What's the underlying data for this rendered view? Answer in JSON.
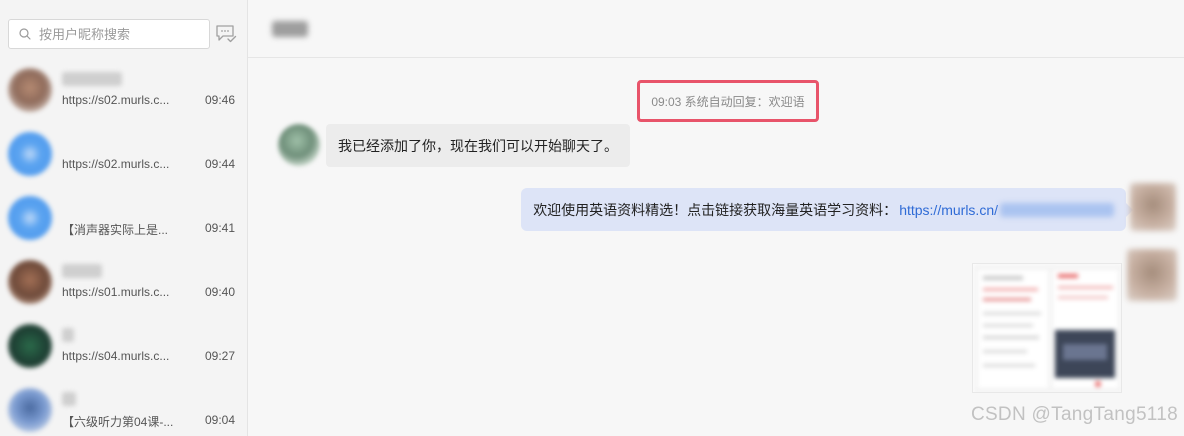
{
  "search": {
    "placeholder": "按用户昵称搜索"
  },
  "icons": {
    "search": "search-icon",
    "message_check": "message-check-icon"
  },
  "conversations": [
    {
      "preview": "https://s02.murls.c...",
      "time": "09:46"
    },
    {
      "preview": "https://s02.murls.c...",
      "time": "09:44"
    },
    {
      "preview": "【消声器实际上是...",
      "time": "09:41"
    },
    {
      "preview": "https://s01.murls.c...",
      "time": "09:40"
    },
    {
      "preview": "https://s04.murls.c...",
      "time": "09:27"
    },
    {
      "preview": "【六级听力第04课-...",
      "time": "09:04"
    }
  ],
  "chat": {
    "system_message": "09:03 系统自动回复：欢迎语",
    "incoming_text": "我已经添加了你，现在我们可以开始聊天了。",
    "outgoing_text": "欢迎使用英语资料精选！点击链接获取海量英语学习资料：",
    "outgoing_link": "https://murls.cn/"
  },
  "colors": {
    "highlight_border": "#e8546a",
    "outgoing_bubble": "#dde4f7",
    "link": "#2f6bd6"
  },
  "watermark": "CSDN @TangTang5118"
}
